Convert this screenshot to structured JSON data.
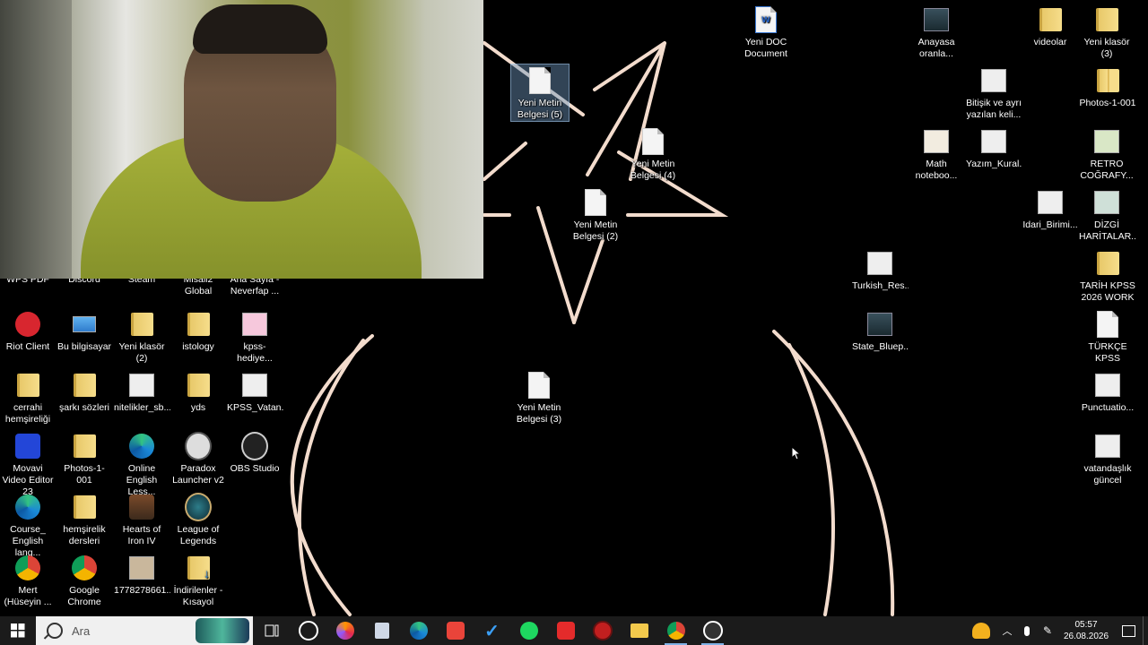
{
  "desktop": {
    "icons": [
      {
        "label": "Yeni DOC Document",
        "kind": "doc-word"
      },
      {
        "label": "Anayasa oranla...",
        "kind": "thumb"
      },
      {
        "label": "videolar",
        "kind": "folder"
      },
      {
        "label": "Yeni klasör (3)",
        "kind": "folder"
      },
      {
        "label": "Yeni Metin Belgesi (5)",
        "kind": "doc"
      },
      {
        "label": "Bitişik ve ayrı yazılan keli...",
        "kind": "thumb"
      },
      {
        "label": "Photos-1-001",
        "kind": "folder-zip"
      },
      {
        "label": "Yeni Metin Belgesi (4)",
        "kind": "doc"
      },
      {
        "label": "Math noteboo...",
        "kind": "thumbw"
      },
      {
        "label": "Yazım_Kural...",
        "kind": "thumbw"
      },
      {
        "label": "RETRO COĞRAFY...",
        "kind": "thumbw"
      },
      {
        "label": "Yeni Metin Belgesi (2)",
        "kind": "doc"
      },
      {
        "label": "Idari_Birimi...",
        "kind": "thumbw"
      },
      {
        "label": "DİZGİ HARİTALAR...",
        "kind": "thumbw"
      },
      {
        "label": "Turkish_Res...",
        "kind": "thumbw"
      },
      {
        "label": "TARİH KPSS 2026 WORK",
        "kind": "folder-zip"
      },
      {
        "label": "State_Bluep...",
        "kind": "thumb"
      },
      {
        "label": "TÜRKÇE KPSS",
        "kind": "doc"
      },
      {
        "label": "Yeni Metin Belgesi (3)",
        "kind": "doc"
      },
      {
        "label": "Punctuatio...",
        "kind": "thumbw"
      },
      {
        "label": "vatandaşlık güncel",
        "kind": "thumbw"
      },
      {
        "label": "WPS PDF",
        "kind": "partial"
      },
      {
        "label": "Discord",
        "kind": "partial"
      },
      {
        "label": "Steam",
        "kind": "partial"
      },
      {
        "label": "Misali2 Global",
        "kind": "partial"
      },
      {
        "label": "Ana Sayfa - Neverfap ...",
        "kind": "partial"
      },
      {
        "label": "Riot Client",
        "kind": "riot"
      },
      {
        "label": "Bu bilgisayar",
        "kind": "pc"
      },
      {
        "label": "Yeni klasör (2)",
        "kind": "folder"
      },
      {
        "label": "istology",
        "kind": "folder"
      },
      {
        "label": "kpss-hediye...",
        "kind": "thumbw"
      },
      {
        "label": "cerrahi hemşireliği",
        "kind": "folder"
      },
      {
        "label": "şarkı sözleri",
        "kind": "folder"
      },
      {
        "label": "nitelikler_sb...",
        "kind": "thumbw"
      },
      {
        "label": "yds",
        "kind": "folder"
      },
      {
        "label": "KPSS_Vatan...",
        "kind": "thumbw"
      },
      {
        "label": "Movavi Video Editor 23",
        "kind": "movavi"
      },
      {
        "label": "Photos-1-001",
        "kind": "folder-zip"
      },
      {
        "label": "Online English Less...",
        "kind": "edge"
      },
      {
        "label": "Paradox Launcher v2",
        "kind": "paradox"
      },
      {
        "label": "OBS Studio",
        "kind": "obs"
      },
      {
        "label": "Course_ English lang...",
        "kind": "edge"
      },
      {
        "label": "hemşirelik dersleri",
        "kind": "folder"
      },
      {
        "label": "Hearts of Iron IV",
        "kind": "hoi"
      },
      {
        "label": "League of Legends",
        "kind": "lol"
      },
      {
        "label": "Mert (Hüseyin ...",
        "kind": "chrome"
      },
      {
        "label": "Google Chrome",
        "kind": "chrome"
      },
      {
        "label": "1778278661...",
        "kind": "thumbw"
      },
      {
        "label": "İndirilenler - Kısayol",
        "kind": "folder-dl"
      }
    ]
  },
  "taskbar": {
    "search_placeholder": "Ara",
    "apps": [
      "task-view",
      "chatgpt",
      "firefox",
      "notepad",
      "edge",
      "app-red",
      "todo",
      "spotify",
      "wps",
      "riot",
      "explorer",
      "chrome",
      "obs"
    ],
    "time": "05:57",
    "date": "26.08.2026"
  }
}
